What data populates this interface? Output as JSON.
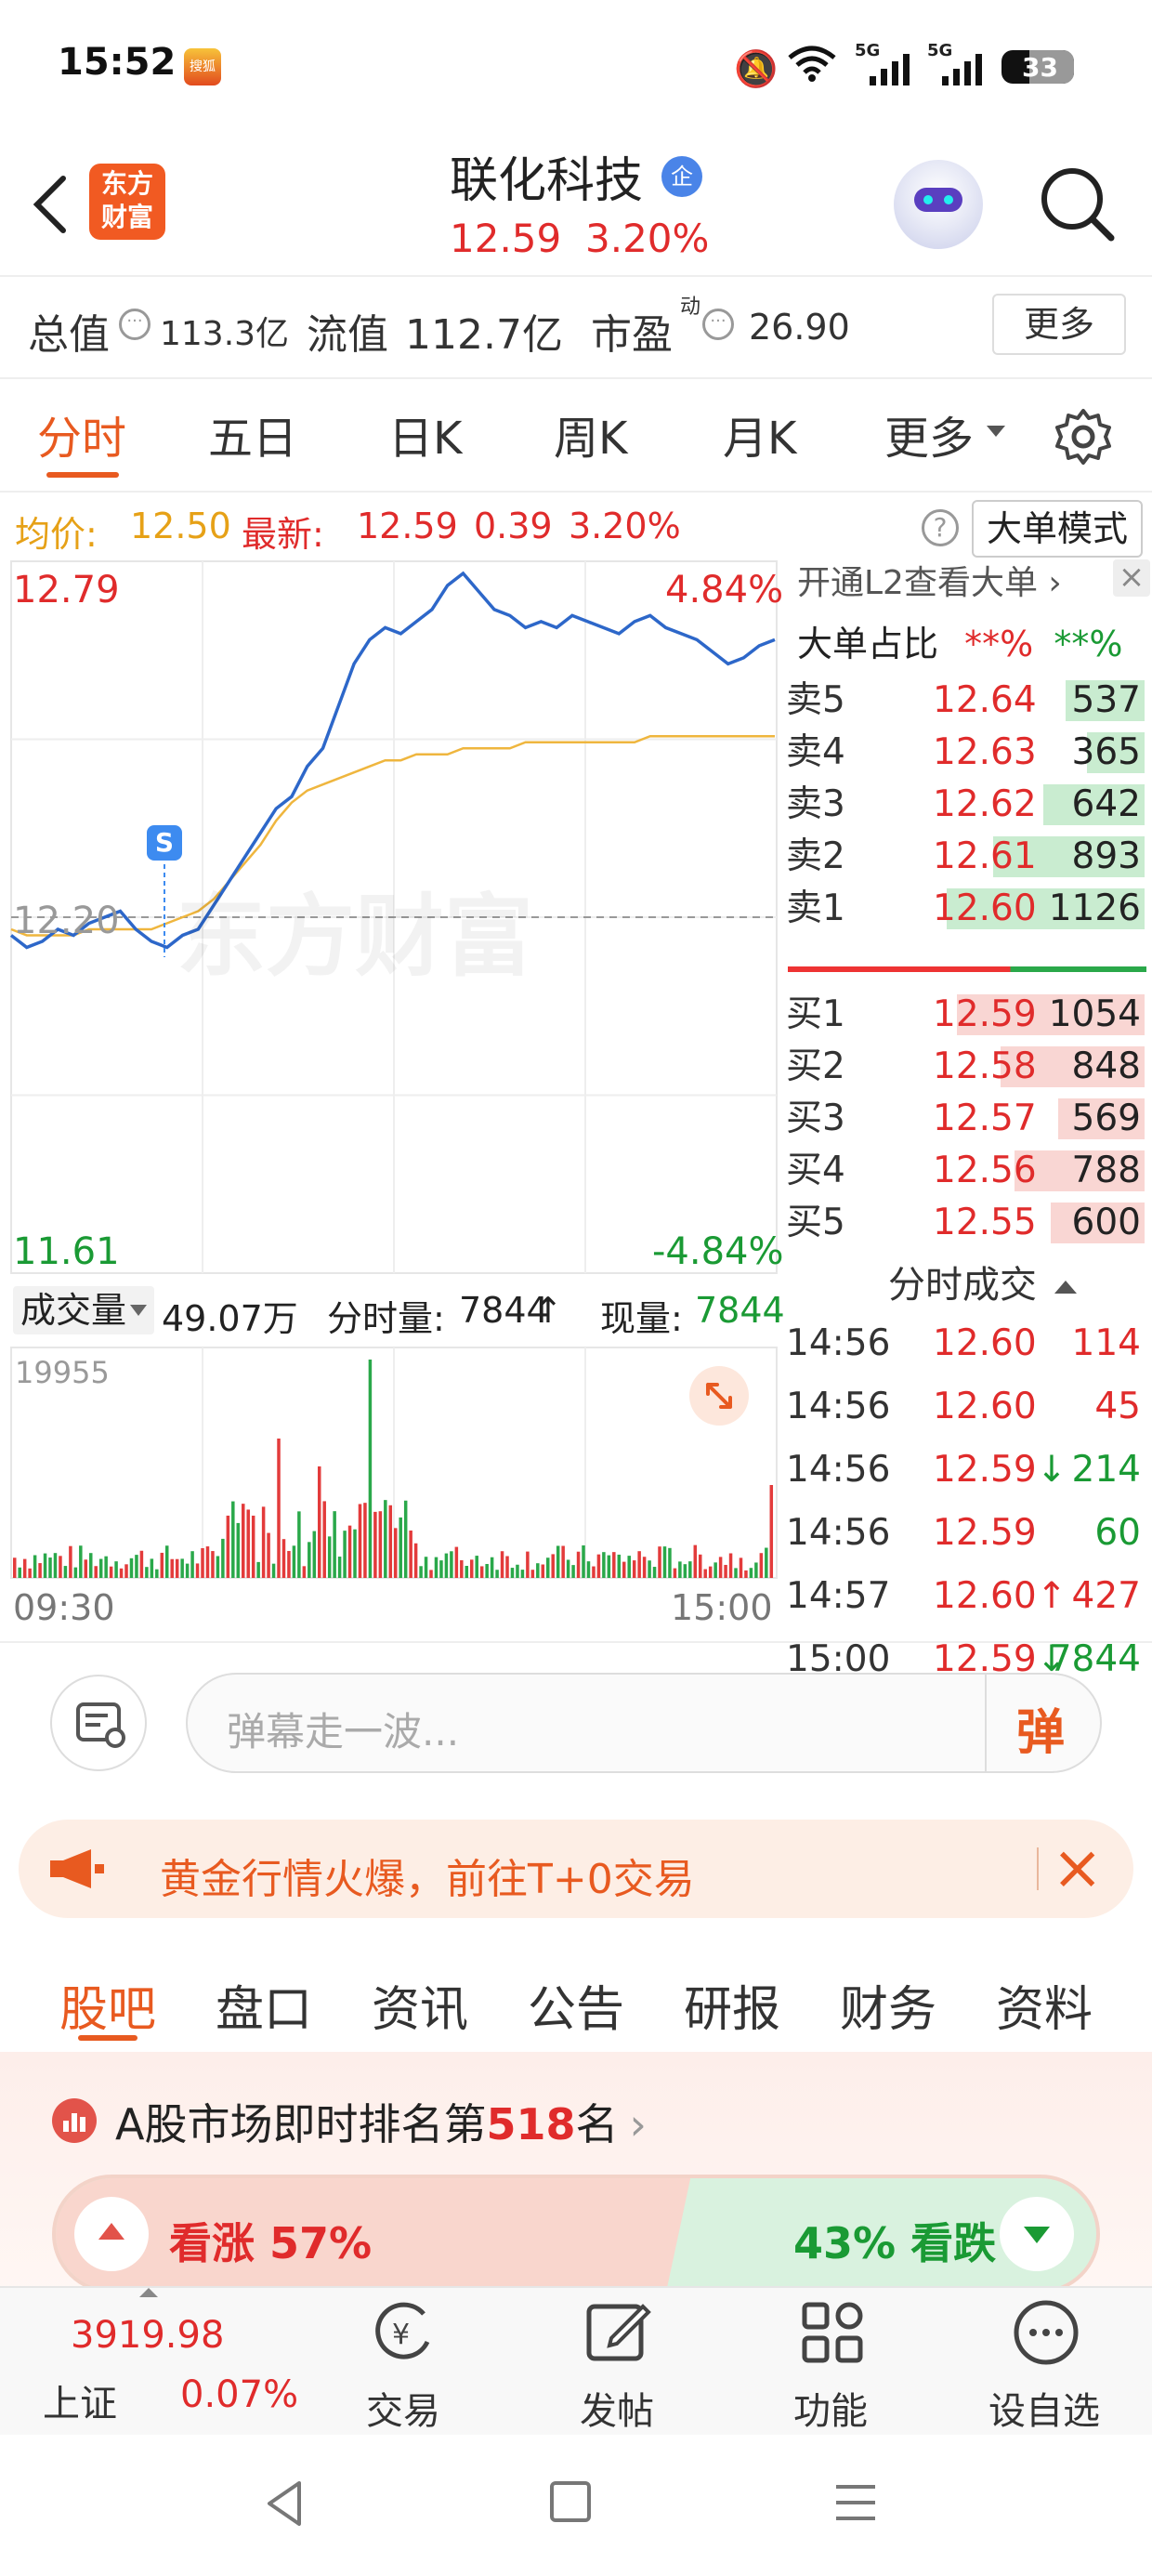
{
  "status": {
    "time": "15:52",
    "app_badge": "搜狐",
    "signal1": "5G",
    "signal2": "5G",
    "battery": "33"
  },
  "header": {
    "name": "联化科技",
    "badge": "企",
    "price": "12.59",
    "pct": "3.20%",
    "logo_line1": "东方",
    "logo_line2": "财富"
  },
  "stats": {
    "total_label": "总值",
    "total_value": "113.3亿",
    "float_label": "流值",
    "float_value": "112.7亿",
    "pe_label": "市盈",
    "pe_sup": "动",
    "pe_value": "26.90",
    "more": "更多"
  },
  "tabs": [
    "分时",
    "五日",
    "日K",
    "周K",
    "月K",
    "更多"
  ],
  "info": {
    "avg_label": "均价:",
    "avg_value": "12.50",
    "latest_label": "最新:",
    "latest_value": "12.59",
    "change": "0.39",
    "pct": "3.20%",
    "mode_btn": "大单模式"
  },
  "chart_labels": {
    "high": "12.79",
    "low": "11.61",
    "high_pct": "4.84%",
    "low_pct": "-4.84%",
    "mid": "12.20",
    "s_marker": "S",
    "watermark": "东方财富"
  },
  "l2": {
    "open_text": "开通L2查看大单",
    "ratio_label": "大单占比",
    "ratio_red": "**%",
    "ratio_green": "**%"
  },
  "asks": [
    {
      "label": "卖5",
      "price": "12.64",
      "vol": "537",
      "fill": 0.22
    },
    {
      "label": "卖4",
      "price": "12.63",
      "vol": "365",
      "fill": 0.16
    },
    {
      "label": "卖3",
      "price": "12.62",
      "vol": "642",
      "fill": 0.28
    },
    {
      "label": "卖2",
      "price": "12.61",
      "vol": "893",
      "fill": 0.42
    },
    {
      "label": "卖1",
      "price": "12.60",
      "vol": "1126",
      "fill": 0.55
    }
  ],
  "bids": [
    {
      "label": "买1",
      "price": "12.59",
      "vol": "1054",
      "fill": 0.52
    },
    {
      "label": "买2",
      "price": "12.58",
      "vol": "848",
      "fill": 0.4
    },
    {
      "label": "买3",
      "price": "12.57",
      "vol": "569",
      "fill": 0.24
    },
    {
      "label": "买4",
      "price": "12.56",
      "vol": "788",
      "fill": 0.36
    },
    {
      "label": "买5",
      "price": "12.55",
      "vol": "600",
      "fill": 0.26
    }
  ],
  "trades_title": "分时成交",
  "trades": [
    {
      "time": "14:56",
      "price": "12.60",
      "arrow": "",
      "vol": "114",
      "pc": "red",
      "vc": "red"
    },
    {
      "time": "14:56",
      "price": "12.60",
      "arrow": "",
      "vol": "45",
      "pc": "red",
      "vc": "red"
    },
    {
      "time": "14:56",
      "price": "12.59",
      "arrow": "↓",
      "vol": "214",
      "pc": "red",
      "vc": "green"
    },
    {
      "time": "14:56",
      "price": "12.59",
      "arrow": "",
      "vol": "60",
      "pc": "red",
      "vc": "green"
    },
    {
      "time": "14:57",
      "price": "12.60",
      "arrow": "↑",
      "vol": "427",
      "pc": "red",
      "vc": "red"
    },
    {
      "time": "15:00",
      "price": "12.59",
      "arrow": "↓",
      "vol": "7844",
      "pc": "red",
      "vc": "green"
    }
  ],
  "volume": {
    "selector": "成交量",
    "total": "49.07万",
    "minute_label": "分时量:",
    "minute_value": "7844",
    "now_label": "现量:",
    "now_value": "7844",
    "max": "19955",
    "start": "09:30",
    "end": "15:00"
  },
  "danmu_placeholder": "弹幕走一波...",
  "danmu_btn": "弹",
  "banner_text": "黄金行情火爆，前往T+0交易",
  "page_tabs": [
    "股吧",
    "盘口",
    "资讯",
    "公告",
    "研报",
    "财务",
    "资料"
  ],
  "rank": {
    "prefix": "A股市场即时排名第",
    "number": "518",
    "suffix": "名"
  },
  "sentiment": {
    "up_label": "看涨 57%",
    "down_label": "43% 看跌",
    "up_ratio": 0.57
  },
  "bottom_nav": {
    "index_value": "3919.98",
    "index_name": "上证",
    "index_pct": "0.07%",
    "trade": "交易",
    "post": "发帖",
    "func": "功能",
    "watch": "设自选"
  },
  "chart_data": {
    "type": "line",
    "x_start": "09:30",
    "x_end": "15:00",
    "ylim": [
      11.61,
      12.79
    ],
    "pct_range": [
      -4.84,
      4.84
    ],
    "prev_close": 12.2,
    "price": [
      12.17,
      12.15,
      12.16,
      12.18,
      12.17,
      12.19,
      12.2,
      12.21,
      12.18,
      12.16,
      12.15,
      12.17,
      12.18,
      12.22,
      12.26,
      12.3,
      12.34,
      12.38,
      12.4,
      12.45,
      12.48,
      12.55,
      12.62,
      12.66,
      12.68,
      12.67,
      12.69,
      12.71,
      12.75,
      12.77,
      12.74,
      12.71,
      12.7,
      12.68,
      12.69,
      12.68,
      12.7,
      12.69,
      12.68,
      12.67,
      12.69,
      12.7,
      12.68,
      12.67,
      12.66,
      12.64,
      12.62,
      12.63,
      12.65,
      12.66
    ],
    "avg": [
      12.18,
      12.17,
      12.17,
      12.17,
      12.17,
      12.18,
      12.18,
      12.18,
      12.18,
      12.18,
      12.19,
      12.2,
      12.21,
      12.23,
      12.26,
      12.29,
      12.32,
      12.36,
      12.39,
      12.41,
      12.42,
      12.43,
      12.44,
      12.45,
      12.46,
      12.46,
      12.47,
      12.47,
      12.47,
      12.48,
      12.48,
      12.48,
      12.48,
      12.49,
      12.49,
      12.49,
      12.49,
      12.49,
      12.49,
      12.49,
      12.49,
      12.5,
      12.5,
      12.5,
      12.5,
      12.5,
      12.5,
      12.5,
      12.5,
      12.5
    ]
  }
}
